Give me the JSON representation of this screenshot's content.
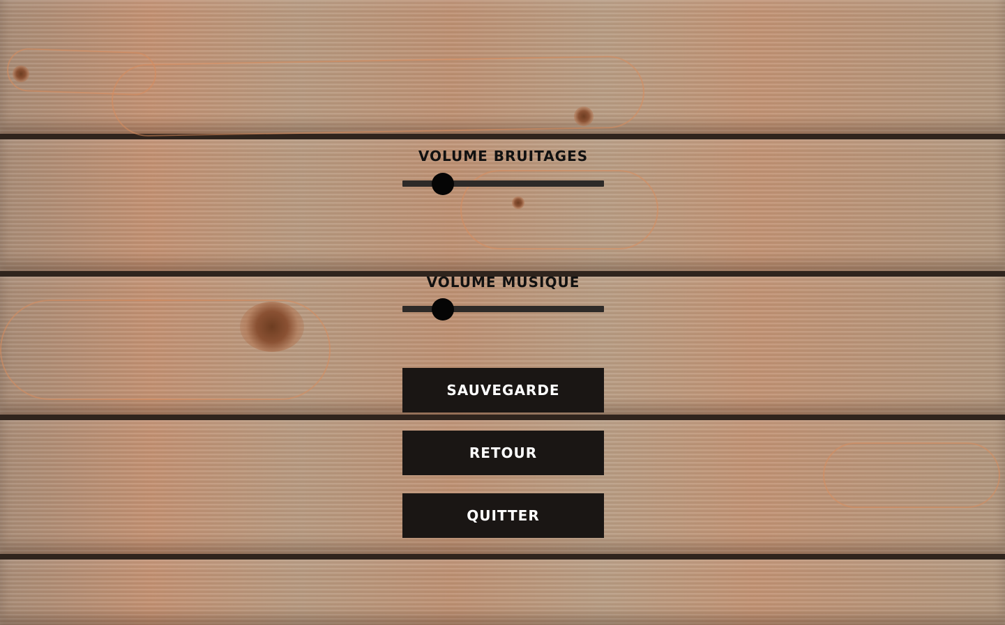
{
  "settings": {
    "sound_effects_label": "VOLUME BRUITAGES",
    "sound_effects_value": 0.2,
    "music_label": "VOLUME MUSIQUE",
    "music_value": 0.2
  },
  "buttons": {
    "save_label": "SAUVEGARDE",
    "back_label": "RETOUR",
    "quit_label": "QUITTER"
  },
  "colors": {
    "button_bg": "#1a1614",
    "button_text": "#ffffff",
    "label_text": "#111111",
    "slider_track": "#2d2a28",
    "slider_thumb": "#050505"
  }
}
